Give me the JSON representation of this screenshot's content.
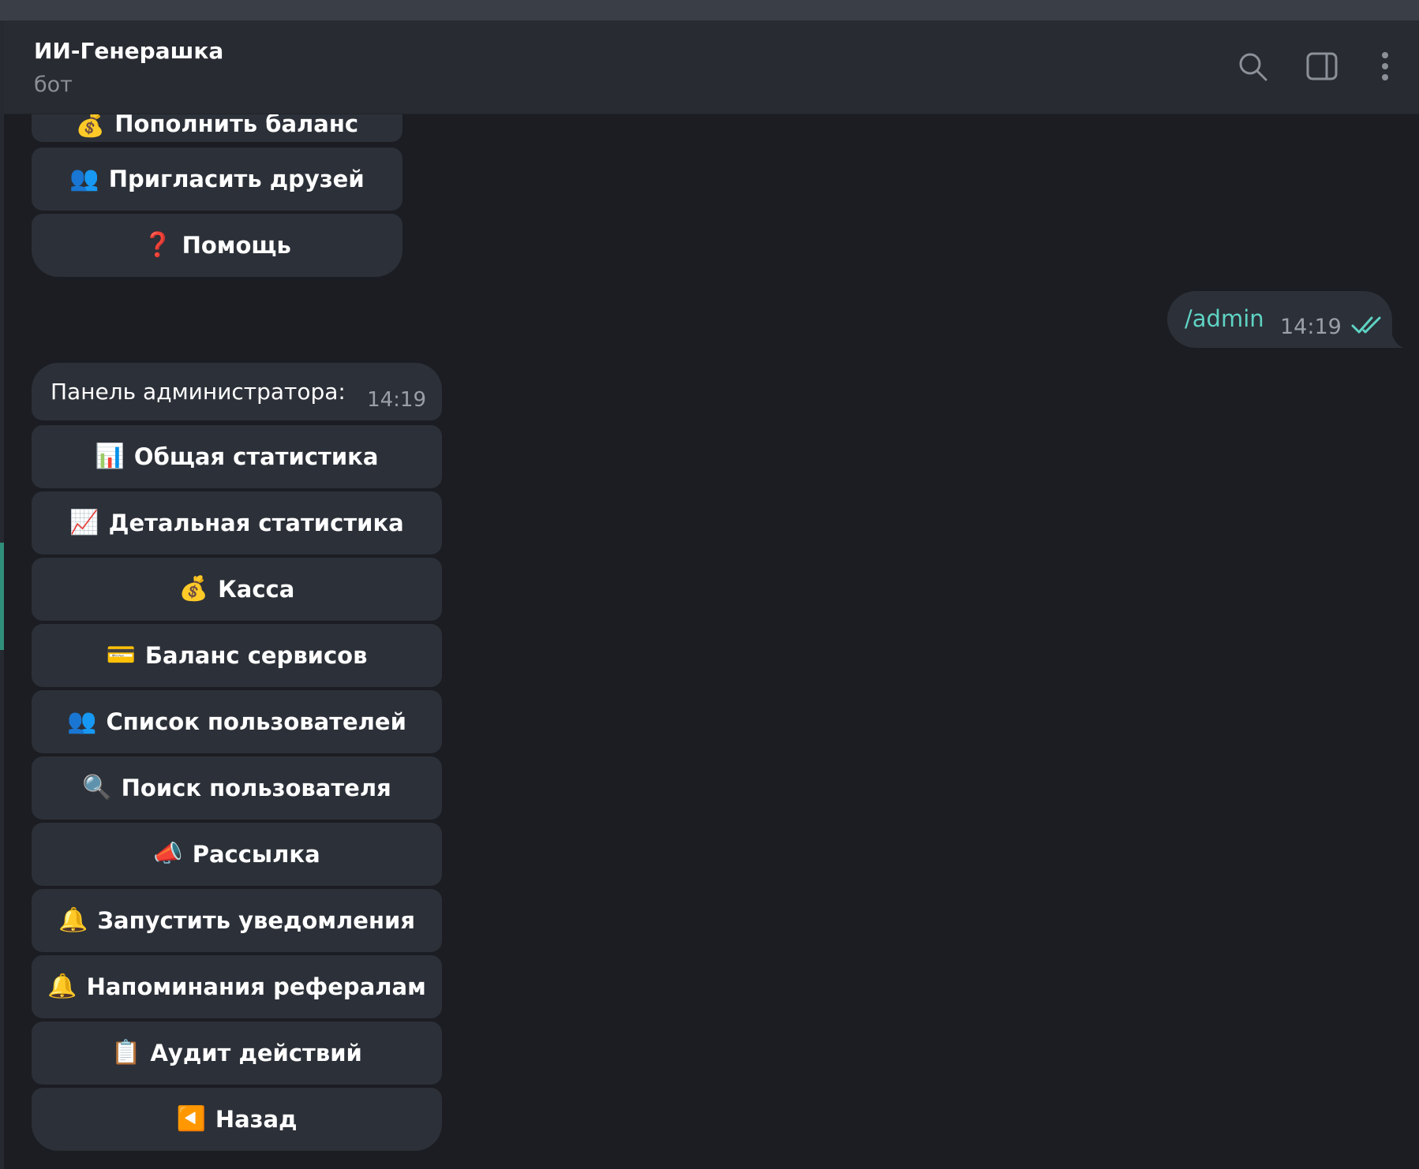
{
  "header": {
    "title": "ИИ-Генерашка",
    "subtitle": "бот",
    "icons": [
      "search-icon",
      "sidebar-toggle-icon",
      "more-vertical-icon"
    ]
  },
  "top_keyboard": [
    {
      "emoji": "💰",
      "label": "Пополнить баланс",
      "partial": true
    },
    {
      "emoji": "👥",
      "label": "Пригласить друзей"
    },
    {
      "emoji": "❓",
      "label": "Помощь"
    }
  ],
  "outgoing_message": {
    "text": "/admin",
    "time": "14:19",
    "status_icon": "double-check-icon"
  },
  "incoming_message": {
    "text": "Панель администратора:",
    "time": "14:19"
  },
  "admin_keyboard": [
    {
      "emoji": "📊",
      "label": "Общая статистика"
    },
    {
      "emoji": "📈",
      "label": "Детальная статистика"
    },
    {
      "emoji": "💰",
      "label": "Касса"
    },
    {
      "emoji": "💳",
      "label": "Баланс сервисов"
    },
    {
      "emoji": "👥",
      "label": "Список пользователей"
    },
    {
      "emoji": "🔍",
      "label": "Поиск пользователя"
    },
    {
      "emoji": "📣",
      "label": "Рассылка"
    },
    {
      "emoji": "🔔",
      "label": "Запустить уведомления"
    },
    {
      "emoji": "🔔",
      "label": "Напоминания рефералам"
    },
    {
      "emoji": "📋",
      "label": "Аудит действий"
    },
    {
      "emoji": "◀️",
      "label": "Назад"
    }
  ],
  "colors": {
    "background": "#1b1d22",
    "header": "#282b31",
    "button": "#2c3038",
    "accent": "#5fd3c4"
  }
}
